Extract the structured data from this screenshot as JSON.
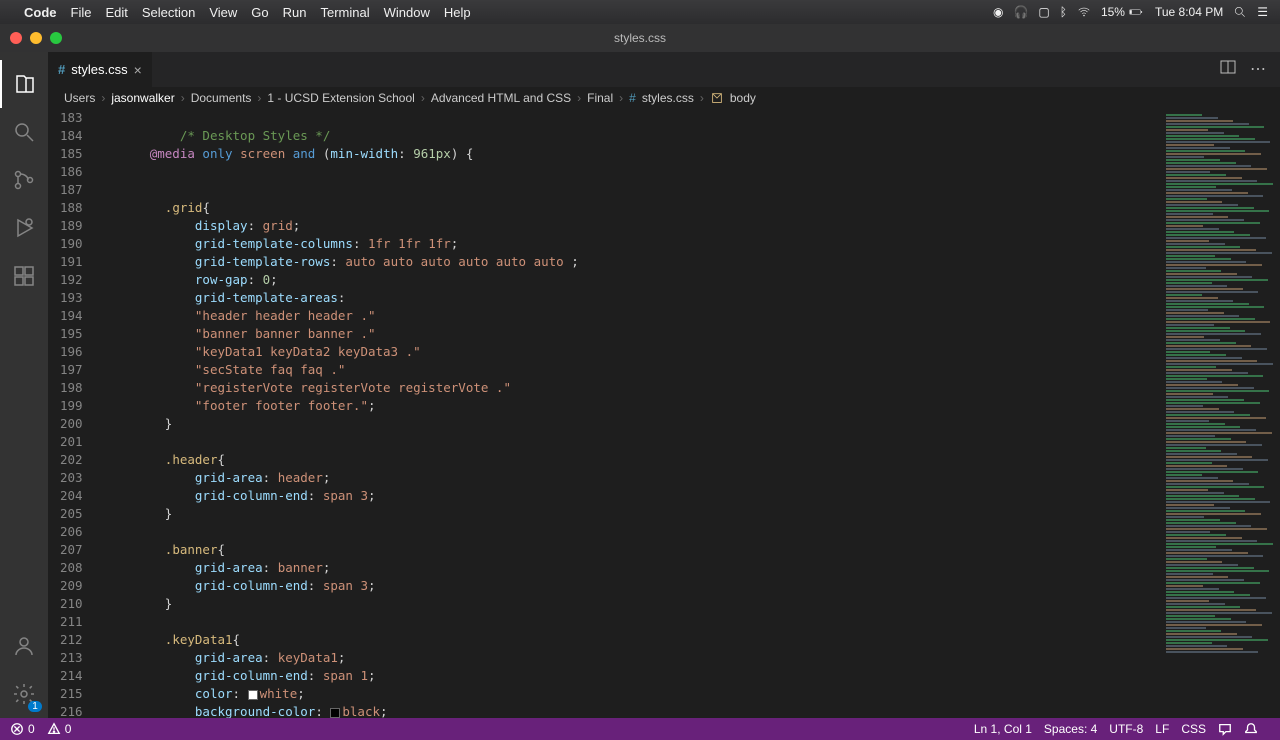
{
  "menubar": {
    "app": "Code",
    "items": [
      "File",
      "Edit",
      "Selection",
      "View",
      "Go",
      "Run",
      "Terminal",
      "Window",
      "Help"
    ],
    "battery": "15%",
    "clock": "Tue 8:04 PM"
  },
  "window": {
    "title": "styles.css"
  },
  "tab": {
    "filename": "styles.css"
  },
  "breadcrumbs": {
    "parts": [
      "Users",
      "jasonwalker",
      "Documents",
      "1 - UCSD Extension School",
      "Advanced HTML and CSS",
      "Final",
      "styles.css",
      "body"
    ]
  },
  "activity_icons": [
    "explorer",
    "search",
    "source-control",
    "run-debug",
    "extensions"
  ],
  "activity_bottom": [
    "accounts",
    "settings"
  ],
  "settings_badge": "1",
  "line_start": 183,
  "code_lines": [
    {
      "t": "blank"
    },
    {
      "t": "comment",
      "text": "/* Desktop Styles */",
      "indent": 10
    },
    {
      "t": "media",
      "at": "@media",
      "only": "only",
      "screen": "screen",
      "and": "and",
      "open": "(",
      "prop": "min-width",
      "val": "961px",
      "close": ") {",
      "indent": 6
    },
    {
      "t": "blank"
    },
    {
      "t": "blank"
    },
    {
      "t": "sel",
      "name": ".grid",
      "open": "{",
      "indent": 8
    },
    {
      "t": "decl",
      "prop": "display",
      "val": "grid",
      "sep": ": ",
      "end": ";",
      "indent": 12,
      "valcls": "tok-val"
    },
    {
      "t": "decl",
      "prop": "grid-template-columns",
      "val": "1fr 1fr 1fr",
      "sep": ": ",
      "end": ";",
      "indent": 12,
      "valcls": "tok-val"
    },
    {
      "t": "decl",
      "prop": "grid-template-rows",
      "val": "auto auto auto auto auto auto ",
      "sep": ": ",
      "end": ";",
      "indent": 12,
      "valcls": "tok-val"
    },
    {
      "t": "decl",
      "prop": "row-gap",
      "val": "0",
      "sep": ": ",
      "end": ";",
      "indent": 12,
      "valcls": "tok-num"
    },
    {
      "t": "decl",
      "prop": "grid-template-areas",
      "val": "",
      "sep": ":",
      "end": "",
      "indent": 12,
      "valcls": ""
    },
    {
      "t": "str",
      "text": "\"header header header .\"",
      "indent": 12
    },
    {
      "t": "str",
      "text": "\"banner banner banner .\"",
      "indent": 12
    },
    {
      "t": "str",
      "text": "\"keyData1 keyData2 keyData3 .\"",
      "indent": 12
    },
    {
      "t": "str",
      "text": "\"secState faq faq .\"",
      "indent": 12
    },
    {
      "t": "str",
      "text": "\"registerVote registerVote registerVote .\"",
      "indent": 12
    },
    {
      "t": "str",
      "text": "\"footer footer footer.\"",
      "end": ";",
      "indent": 12
    },
    {
      "t": "close",
      "text": "}",
      "indent": 8
    },
    {
      "t": "blank"
    },
    {
      "t": "sel",
      "name": ".header",
      "open": "{",
      "indent": 8
    },
    {
      "t": "decl",
      "prop": "grid-area",
      "val": "header",
      "sep": ": ",
      "end": ";",
      "indent": 12,
      "valcls": "tok-val"
    },
    {
      "t": "decl",
      "prop": "grid-column-end",
      "val": "span 3",
      "sep": ": ",
      "end": ";",
      "indent": 12,
      "valcls": "tok-val"
    },
    {
      "t": "close",
      "text": "}",
      "indent": 8
    },
    {
      "t": "blank"
    },
    {
      "t": "sel",
      "name": ".banner",
      "open": "{",
      "indent": 8
    },
    {
      "t": "decl",
      "prop": "grid-area",
      "val": "banner",
      "sep": ": ",
      "end": ";",
      "indent": 12,
      "valcls": "tok-val"
    },
    {
      "t": "decl",
      "prop": "grid-column-end",
      "val": "span 3",
      "sep": ": ",
      "end": ";",
      "indent": 12,
      "valcls": "tok-val"
    },
    {
      "t": "close",
      "text": "}",
      "indent": 8
    },
    {
      "t": "blank"
    },
    {
      "t": "sel",
      "name": ".keyData1",
      "open": "{",
      "indent": 8
    },
    {
      "t": "decl",
      "prop": "grid-area",
      "val": "keyData1",
      "sep": ": ",
      "end": ";",
      "indent": 12,
      "valcls": "tok-val"
    },
    {
      "t": "decl",
      "prop": "grid-column-end",
      "val": "span 1",
      "sep": ": ",
      "end": ";",
      "indent": 12,
      "valcls": "tok-val"
    },
    {
      "t": "decl",
      "prop": "color",
      "val": "white",
      "sep": ": ",
      "end": ";",
      "indent": 12,
      "valcls": "tok-val",
      "swatch": "#fff"
    },
    {
      "t": "decl",
      "prop": "background-color",
      "val": "black",
      "sep": ": ",
      "end": ";",
      "indent": 12,
      "valcls": "tok-val",
      "swatch": "#000"
    }
  ],
  "statusbar": {
    "errors": "0",
    "warnings": "0",
    "lncol": "Ln 1, Col 1",
    "spaces": "Spaces: 4",
    "encoding": "UTF-8",
    "eol": "LF",
    "lang": "CSS"
  }
}
